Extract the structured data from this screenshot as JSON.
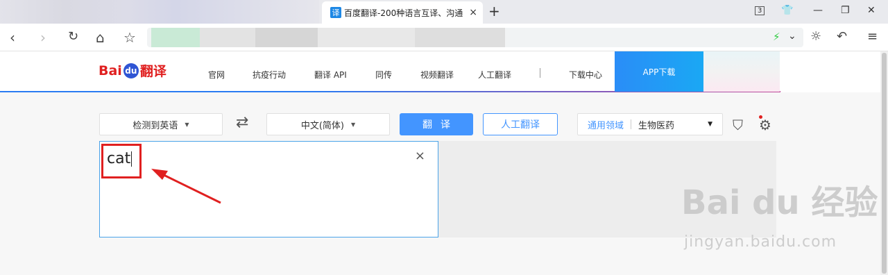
{
  "browser": {
    "tab_title": "百度翻译-200种语言互译、沟通",
    "tab_favicon": "译",
    "tab_count": "3",
    "new_tab": "+",
    "close": "×",
    "nav": {
      "back": "‹",
      "forward": "›",
      "reload": "↻",
      "home": "⌂",
      "star": "☆"
    },
    "toolbar_icons": {
      "theme": "☼",
      "undo": "↶",
      "menu": "≡"
    }
  },
  "site": {
    "logo_bai": "Bai",
    "logo_du": "du",
    "logo_fanyi": "翻译",
    "nav_links": [
      "官网",
      "抗疫行动",
      "翻译 API",
      "同传",
      "视频翻译",
      "人工翻译",
      "下载中心"
    ],
    "app_button": "APP下载"
  },
  "controls": {
    "source_lang": "检测到英语",
    "target_lang": "中文(简体)",
    "swap_icon": "⇄",
    "translate_button": "翻译",
    "human_translate_button": "人工翻译",
    "domain_label": "通用领域",
    "domain_value": "生物医药"
  },
  "input": {
    "text": "cat",
    "clear": "×"
  },
  "watermark": {
    "text": "Bai du 经验",
    "url": "jingyan.baidu.com"
  },
  "colors": {
    "accent": "#4395ff",
    "annotation_red": "#e02020"
  }
}
